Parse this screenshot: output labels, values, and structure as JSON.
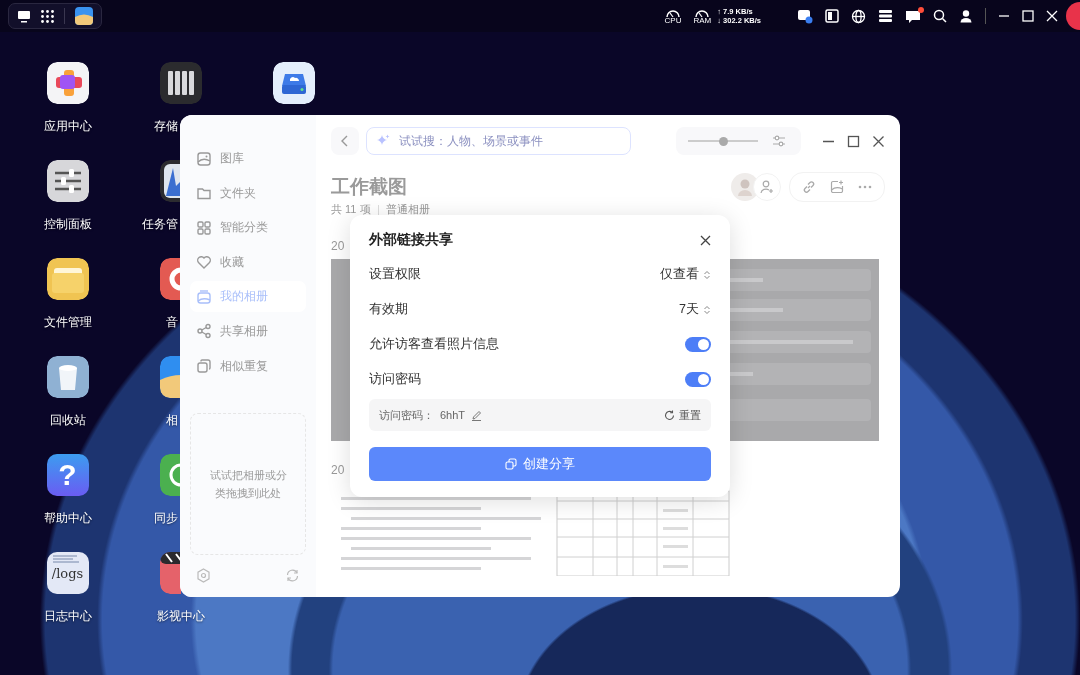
{
  "taskbar": {
    "cpu_label": "CPU",
    "ram_label": "RAM",
    "upload": "↑ 7.9 KB/s",
    "download": "↓ 302.2 KB/s",
    "notification_dot": true
  },
  "desktop": {
    "columns": [
      {
        "icons": [
          {
            "kind": "apps",
            "label": "应用中心"
          },
          {
            "kind": "control",
            "label": "控制面板"
          },
          {
            "kind": "files",
            "label": "文件管理"
          },
          {
            "kind": "trash",
            "label": "回收站"
          },
          {
            "kind": "help",
            "label": "帮助中心",
            "icon_text": "?"
          },
          {
            "kind": "logs",
            "label": "日志中心",
            "icon_text": "/logs"
          }
        ]
      },
      {
        "icons": [
          {
            "kind": "storage",
            "label": "存储"
          },
          {
            "kind": "monitor",
            "label": "任务管"
          },
          {
            "kind": "music",
            "label": "音"
          },
          {
            "kind": "photos",
            "label": "相"
          },
          {
            "kind": "sync",
            "label": "同步"
          },
          {
            "kind": "video",
            "label": "影视中心"
          }
        ]
      },
      {
        "icons": [
          {
            "kind": "drive"
          }
        ]
      }
    ]
  },
  "album_window": {
    "sidebar": {
      "items": [
        {
          "kind": "gallery",
          "label": "图库",
          "selected": false
        },
        {
          "kind": "folder",
          "label": "文件夹",
          "selected": false
        },
        {
          "kind": "grid",
          "label": "智能分类",
          "selected": false
        },
        {
          "kind": "heart",
          "label": "收藏",
          "selected": false
        },
        {
          "kind": "album",
          "label": "我的相册",
          "selected": true
        },
        {
          "kind": "share",
          "label": "共享相册",
          "selected": false
        },
        {
          "kind": "similar",
          "label": "相似重复",
          "selected": false
        }
      ],
      "drop_hint": "试试把相册或分类拖拽到此处"
    },
    "search": {
      "placeholder": "试试搜：人物、场景或事件"
    },
    "zoom_slider": {
      "level": 0.5
    },
    "title": "工作截图",
    "item_count": "共 11 项",
    "album_type": "普通相册",
    "sections": [
      {
        "date": "20",
        "kind": "wide"
      },
      {
        "date": "20",
        "kind": "docs"
      }
    ]
  },
  "share_dialog": {
    "title": "外部链接共享",
    "rows": [
      {
        "kind": "select",
        "label": "设置权限",
        "value": "仅查看"
      },
      {
        "kind": "select",
        "label": "有效期",
        "value": "7天"
      },
      {
        "kind": "toggle",
        "label": "允许访客查看照片信息",
        "on": true
      },
      {
        "kind": "toggle",
        "label": "访问密码",
        "on": true
      }
    ],
    "password_label": "访问密码：",
    "password": "6hhT",
    "reset": "重置",
    "create_button": "创建分享"
  }
}
